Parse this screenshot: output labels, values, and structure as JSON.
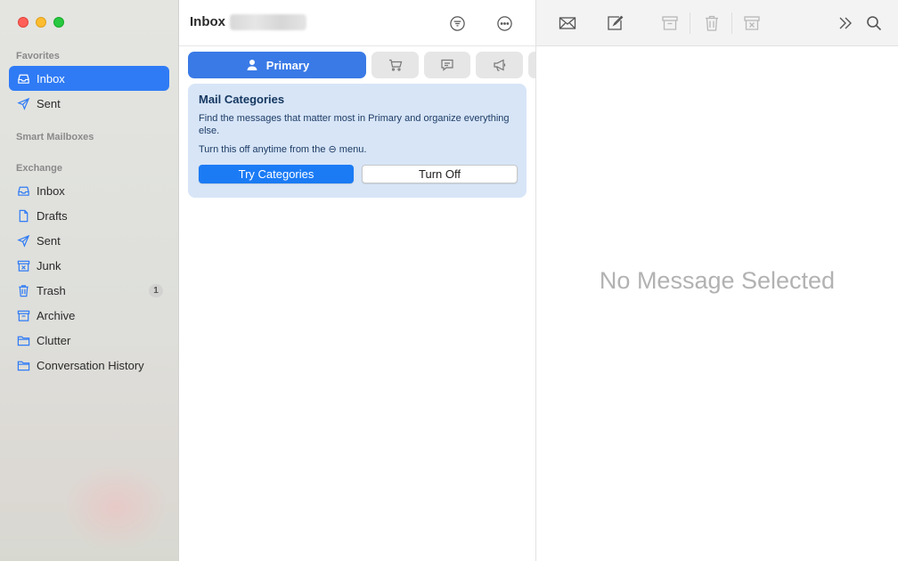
{
  "sidebar": {
    "favorites_header": "Favorites",
    "favorites": [
      {
        "label": "Inbox",
        "icon": "inbox-icon"
      },
      {
        "label": "Sent",
        "icon": "sent-icon"
      }
    ],
    "smart_header": "Smart Mailboxes",
    "exchange_header": "Exchange",
    "exchange": [
      {
        "label": "Inbox",
        "icon": "inbox-icon"
      },
      {
        "label": "Drafts",
        "icon": "drafts-icon"
      },
      {
        "label": "Sent",
        "icon": "sent-icon"
      },
      {
        "label": "Junk",
        "icon": "junk-icon"
      },
      {
        "label": "Trash",
        "icon": "trash-icon",
        "count": "1"
      },
      {
        "label": "Archive",
        "icon": "archive-icon"
      },
      {
        "label": "Clutter",
        "icon": "folder-icon"
      },
      {
        "label": "Conversation History",
        "icon": "folder-icon"
      }
    ]
  },
  "list": {
    "title": "Inbox",
    "tabs": [
      {
        "label": "Primary",
        "icon": "person-icon"
      },
      {
        "icon": "shopping-cart-icon"
      },
      {
        "icon": "message-bubble-icon"
      },
      {
        "icon": "megaphone-icon"
      }
    ]
  },
  "callout": {
    "title": "Mail Categories",
    "body": "Find the messages that matter most in Primary and organize everything else.",
    "hint_prefix": "Turn this off anytime from the",
    "hint_glyph": "⊖",
    "hint_suffix": "menu.",
    "try_label": "Try Categories",
    "off_label": "Turn Off"
  },
  "detail": {
    "empty_text": "No Message Selected"
  },
  "colors": {
    "accent": "#2f7bf5",
    "callout_bg": "#d7e5f7",
    "close": "#ff5f57",
    "minimize": "#febc2e",
    "zoom": "#28c840"
  }
}
